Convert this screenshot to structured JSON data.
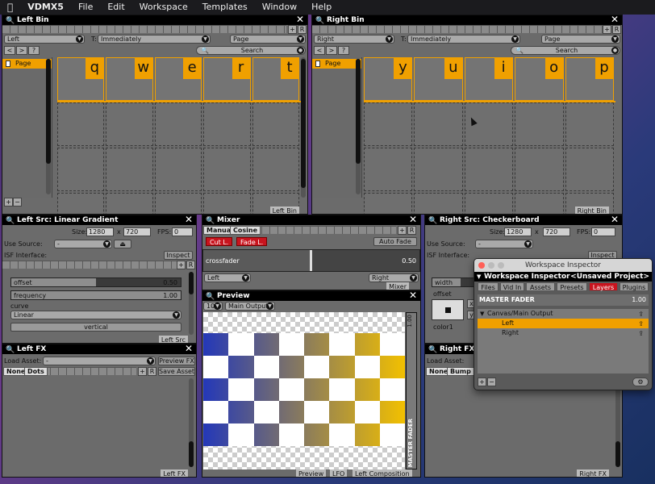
{
  "menubar": {
    "app": "VDMX5",
    "items": [
      "File",
      "Edit",
      "Workspace",
      "Templates",
      "Window",
      "Help"
    ]
  },
  "left_bin": {
    "title": "Left Bin",
    "layer_select": "Left",
    "transition_label": "T:",
    "transition_select": "Immediately",
    "page_select": "Page",
    "search_label": "Search",
    "page_name": "Page",
    "keys": [
      "q",
      "w",
      "e",
      "r",
      "t"
    ],
    "footer_tag": "Left Bin",
    "plus": "+",
    "minus": "−",
    "nav": [
      "<",
      ">",
      "?"
    ],
    "rbtn": "R"
  },
  "right_bin": {
    "title": "Right Bin",
    "layer_select": "Right",
    "transition_label": "T:",
    "transition_select": "Immediately",
    "page_select": "Page",
    "search_label": "Search",
    "page_name": "Page",
    "keys": [
      "y",
      "u",
      "i",
      "o",
      "p"
    ],
    "footer_tag": "Right Bin",
    "nav": [
      "<",
      ">",
      "?"
    ]
  },
  "left_src": {
    "title": "Left Src: Linear Gradient",
    "size_label": "Size:",
    "width": "1280",
    "x_label": "x",
    "height": "720",
    "fps_label": "FPS:",
    "fps": "0",
    "use_source_label": "Use Source:",
    "use_source_value": "-",
    "eject": "⏏",
    "isf_label": "ISF Interface:",
    "inspect": "Inspect",
    "params": [
      {
        "name": "offset",
        "value": "0.50",
        "level": 0.5
      },
      {
        "name": "frequency",
        "value": "1.00",
        "level": 1.0
      }
    ],
    "curve_label": "curve",
    "curve_value": "Linear",
    "vertical_label": "vertical",
    "footer_tag": "Left Src"
  },
  "mixer": {
    "title": "Mixer",
    "tabs": [
      "Manual",
      "Cosine"
    ],
    "cut": "Cut L.",
    "fade": "Fade L.",
    "auto_fade": "Auto Fade",
    "crossfader_label": "crossfader",
    "crossfader_value": "0.50",
    "crossfader_level": 0.5,
    "left": "Left",
    "right": "Right",
    "footer_tag": "Mixer"
  },
  "right_src": {
    "title": "Right Src: Checkerboard",
    "size_label": "Size:",
    "width": "1280",
    "x_label": "x",
    "height": "720",
    "fps_label": "FPS:",
    "fps": "0",
    "use_source_label": "Use Source:",
    "use_source_value": "-",
    "isf_label": "ISF Interface:",
    "inspect": "Inspect",
    "width_label": "width",
    "offset_label": "offset",
    "color1_label": "color1",
    "x_btn": "x",
    "y_btn": "y"
  },
  "preview": {
    "title": "Preview",
    "zoom": "10",
    "output": "Main Output",
    "fader_value": "1.00",
    "fader_label": "MASTER FADER",
    "footer_tags": [
      "Preview",
      "LFO",
      "Left Composition"
    ],
    "colors": {
      "blue": "#2438b8",
      "yellow": "#f2c000",
      "white": "#ffffff"
    }
  },
  "left_fx": {
    "title": "Left FX",
    "load_label": "Load Asset:",
    "load_value": "-",
    "preview_fx": "Preview FX",
    "none": "None",
    "dots": "Dots",
    "save_asset": "Save Asset",
    "footer_tag": "Left FX"
  },
  "right_fx": {
    "title": "Right FX",
    "load_label": "Load Asset:",
    "none": "None",
    "bump": "Bump",
    "footer_tag": "Right FX"
  },
  "inspector": {
    "window_title": "Workspace Inspector",
    "header": "Workspace Inspector",
    "project": "<Unsaved Project>",
    "tabs": [
      "Files",
      "Vid In",
      "Assets",
      "Presets",
      "Layers",
      "Plugins"
    ],
    "selected_tab": "Layers",
    "master_label": "MASTER FADER",
    "master_value": "1.00",
    "group": "Canvas/Main Output",
    "layers": [
      "Left",
      "Right"
    ],
    "plus": "+",
    "minus": "−",
    "gear": "⚙"
  },
  "accent": "#f0a000",
  "red": "#c8141e"
}
